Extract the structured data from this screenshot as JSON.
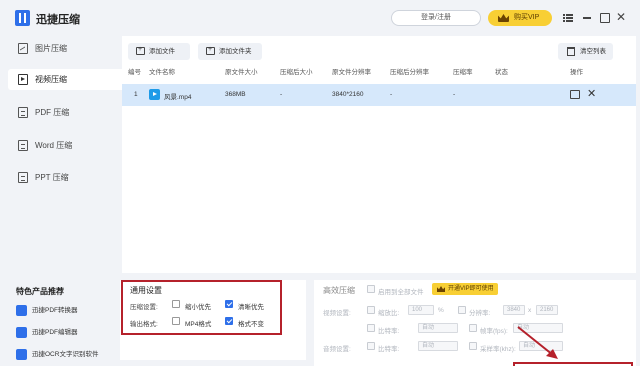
{
  "titlebar": {
    "app_title": "迅捷压缩",
    "login_label": "登录/注册",
    "vip_label": "购买VIP"
  },
  "sidebar": {
    "items": [
      {
        "label": "图片压缩",
        "icon": "image-icon"
      },
      {
        "label": "视频压缩",
        "icon": "video-icon",
        "active": true
      },
      {
        "label": "PDF 压缩",
        "icon": "pdf-icon"
      },
      {
        "label": "Word 压缩",
        "icon": "word-icon"
      },
      {
        "label": "PPT 压缩",
        "icon": "ppt-icon"
      }
    ],
    "featured_title": "特色产品推荐",
    "featured": [
      {
        "label": "迅捷PDF转换器",
        "color": "#2e6fe9"
      },
      {
        "label": "迅捷PDF编辑器",
        "color": "#2e6fe9"
      },
      {
        "label": "迅捷OCR文字识别软件",
        "color": "#2e6fe9"
      }
    ]
  },
  "toolbar": {
    "add_file": "添加文件",
    "add_folder": "添加文件夹",
    "clear_list": "清空列表"
  },
  "table": {
    "columns": [
      "编号",
      "文件名称",
      "原文件大小",
      "压缩后大小",
      "原文件分辨率",
      "压缩后分辨率",
      "压缩率",
      "状态",
      "操作"
    ],
    "rows": [
      {
        "index": "1",
        "name": "风景.mp4",
        "size": "368MB",
        "compressed_size": "-",
        "resolution": "3840*2160",
        "compressed_resolution": "-",
        "ratio": "-"
      }
    ]
  },
  "general_settings": {
    "title": "通用设置",
    "compress_label": "压缩设置:",
    "compress_options": [
      {
        "label": "缩小优先",
        "checked": false
      },
      {
        "label": "清晰优先",
        "checked": true
      }
    ],
    "output_label": "输出格式:",
    "output_options": [
      {
        "label": "MP4格式",
        "checked": false
      },
      {
        "label": "格式不变",
        "checked": true
      }
    ]
  },
  "efficient": {
    "title": "高效压缩",
    "enable_label": "启用到全部文件",
    "vip_label": "开通VIP即可使用",
    "video_label": "视频设置:",
    "ratio_label": "缩放比:",
    "ratio_value": "100",
    "ratio_unit": "%",
    "resolution_label": "分辨率:",
    "res_w": "3840",
    "res_x": "x",
    "res_h": "2160",
    "bitrate_label": "比特率:",
    "bitrate_value": "自动",
    "fps_label": "帧率(fps):",
    "fps_value": "自动",
    "audio_label": "音频设置:",
    "audio_bitrate_label": "比特率:",
    "audio_bitrate_value": "自动",
    "sample_label": "采样率(khz):",
    "sample_value": "自动"
  },
  "colors": {
    "accent": "#2e6fe9",
    "vip": "#f8cf34",
    "selected_row": "#d6e8fb",
    "highlight_box": "#b5212b"
  }
}
